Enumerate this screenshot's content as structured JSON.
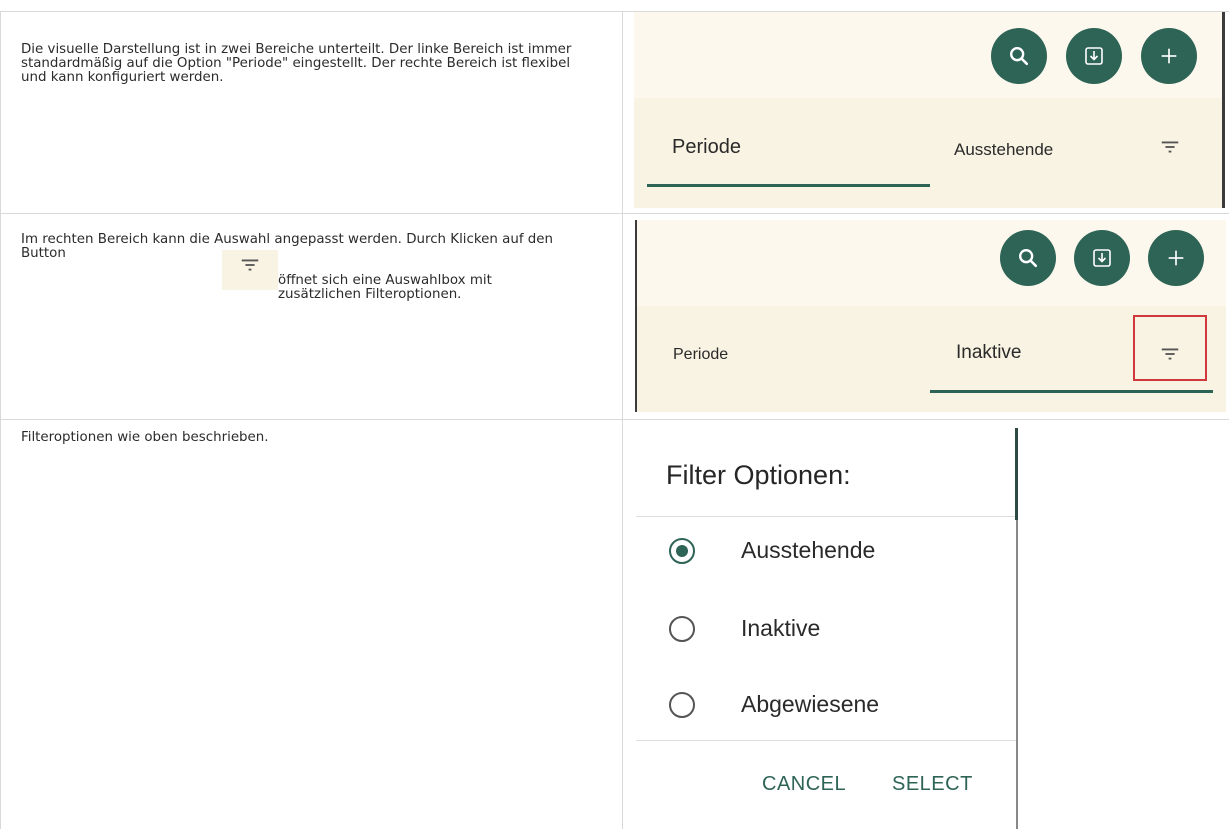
{
  "rows": [
    {
      "description": "Die visuelle Darstellung ist in zwei Bereiche unterteilt. Der linke Bereich ist immer standardmäßig auf die Option \"Periode\" eingestellt. Der rechte Bereich ist flexibel und kann konfiguriert werden.",
      "tabs": [
        "Periode",
        "Ausstehende"
      ],
      "active_tab": "Periode"
    },
    {
      "description_before_icon": "Im rechten Bereich kann die Auswahl angepasst werden. Durch Klicken auf den Button",
      "description_after_icon": "öffnet sich eine Auswahlbox mit zusätzlichen Filteroptionen.",
      "tabs": [
        "Periode",
        "Inaktive"
      ],
      "active_tab": "Inaktive"
    },
    {
      "description": "Filteroptionen wie oben beschrieben."
    }
  ],
  "dialog": {
    "title": "Filter Optionen:",
    "options": [
      {
        "label": "Ausstehende",
        "selected": true
      },
      {
        "label": "Inaktive",
        "selected": false
      },
      {
        "label": "Abgewiesene",
        "selected": false
      }
    ],
    "cancel_label": "CANCEL",
    "select_label": "SELECT"
  },
  "icons": {
    "search": "search-icon",
    "download": "download-icon",
    "add": "add-icon",
    "filter": "filter-icon"
  },
  "colors": {
    "accent": "#2e6456",
    "highlight_box": "#d0393c",
    "panel_bg": "#fcf8ee"
  }
}
